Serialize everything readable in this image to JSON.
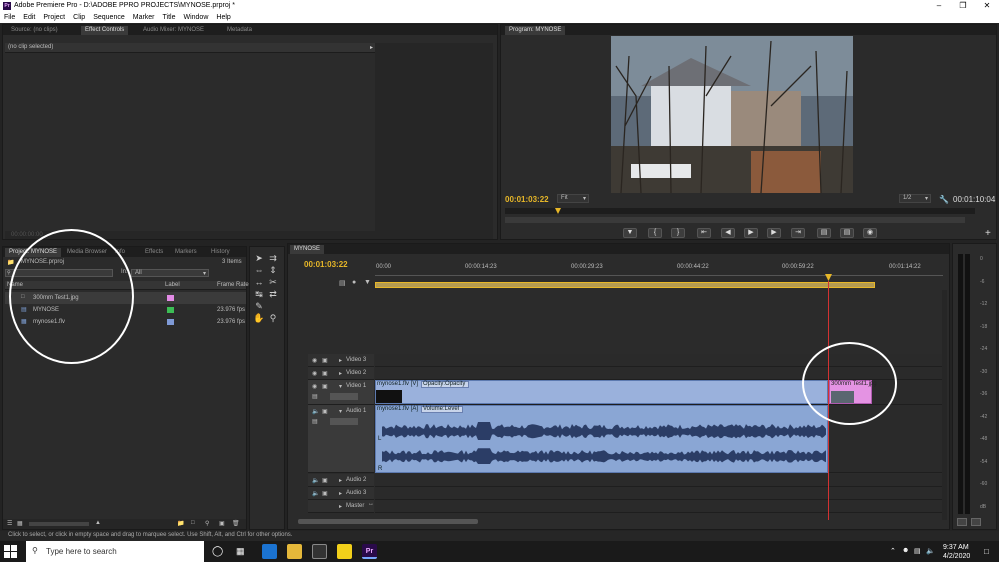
{
  "window": {
    "title": "Adobe Premiere Pro - D:\\ADOBE PPRO PROJECTS\\MYNOSE.prproj *",
    "app_icon": "Pr"
  },
  "menu": [
    "File",
    "Edit",
    "Project",
    "Clip",
    "Sequence",
    "Marker",
    "Title",
    "Window",
    "Help"
  ],
  "source_panel": {
    "tabs": [
      "Source: (no clips)",
      "Effect Controls",
      "Audio Mixer: MYNOSE",
      "Metadata"
    ],
    "active_tab": "Effect Controls",
    "header": "(no clip selected)",
    "timecode": "00:00:00:00"
  },
  "program": {
    "tab": "Program: MYNOSE",
    "timecode": "00:01:03:22",
    "fit": "Fit",
    "resolution": "1/2",
    "duration": "00:01:10:04"
  },
  "project": {
    "tabs": [
      "Project: MYNOSE",
      "Media Browser",
      "Info",
      "Effects",
      "Markers",
      "History"
    ],
    "file": "MYNOSE.prproj",
    "count": "3 Items",
    "in_label": "In:",
    "in_value": "All",
    "columns": [
      "Name",
      "Label",
      "Frame Rate"
    ],
    "items": [
      {
        "name": "300mm Test1.jpg",
        "color": "#e38be6",
        "rate": "",
        "icon": "image-icon"
      },
      {
        "name": "MYNOSE",
        "color": "#3cbd55",
        "rate": "23.976 fps",
        "icon": "sequence-icon"
      },
      {
        "name": "mynose1.flv",
        "color": "#7f9ad6",
        "rate": "23.976 fps",
        "icon": "clip-icon"
      }
    ]
  },
  "timeline": {
    "tab": "MYNOSE",
    "timecode": "00:01:03:22",
    "ruler": [
      "00:00",
      "00:00:14:23",
      "00:00:29:23",
      "00:00:44:22",
      "00:00:59:22",
      "00:01:14:22"
    ],
    "video_tracks": [
      "Video 3",
      "Video 2",
      "Video 1"
    ],
    "audio_tracks": [
      "Audio 1",
      "Audio 2",
      "Audio 3",
      "Master"
    ],
    "clip_v1": "mynose1.flv [V]",
    "clip_v1_fx": "Opacity:Opacity",
    "clip_img": "300mm Test1.jpg",
    "clip_a1": "mynose1.flv [A]",
    "clip_a1_fx": "Volume:Level",
    "channel_l": "L",
    "channel_r": "R"
  },
  "meter": {
    "labels": [
      "0",
      "-6",
      "-12",
      "-18",
      "-24",
      "-30",
      "-36",
      "-42",
      "-48",
      "-54",
      "-60",
      "dB"
    ]
  },
  "tools": [
    "selection-tool",
    "track-select-tool",
    "ripple-edit-tool",
    "rolling-edit-tool",
    "rate-stretch-tool",
    "razor-tool",
    "slip-tool",
    "slide-tool",
    "pen-tool",
    "hand-tool",
    "zoom-tool"
  ],
  "status": "Click to select, or click in empty space and drag to marquee select. Use Shift, Alt, and Ctrl for other options.",
  "taskbar": {
    "search": "Type here to search",
    "time": "9:37 AM",
    "date": "4/2/2020"
  },
  "colors": {
    "accent": "#e7b728",
    "clip_video": "#9ab1dc",
    "clip_audio": "#8aa6d4",
    "clip_image": "#e493e3",
    "playhead": "#d33232"
  }
}
